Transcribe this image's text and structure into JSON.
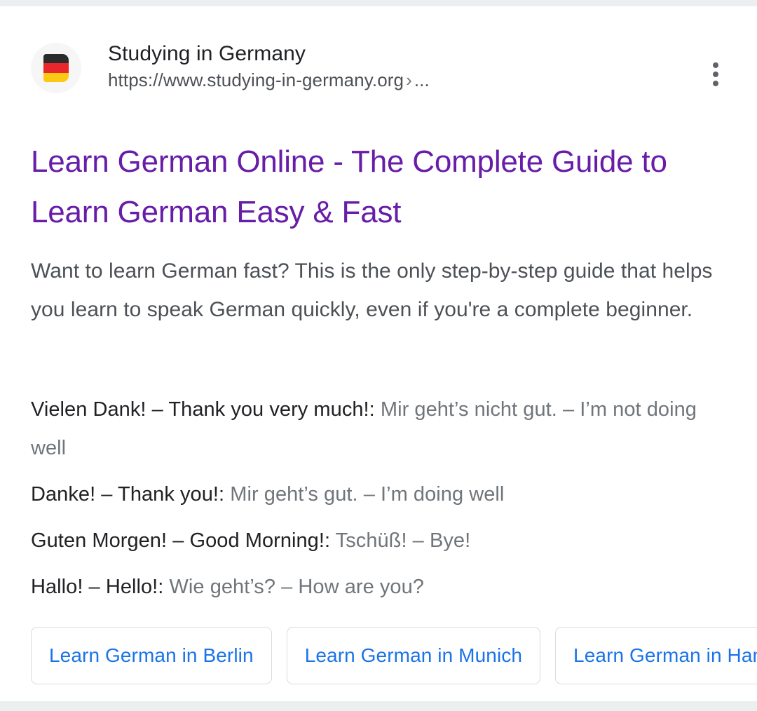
{
  "result": {
    "site": {
      "name": "Studying in Germany",
      "url": "https://www.studying-in-germany.org",
      "url_separator": "›",
      "url_ellipsis": "...",
      "favicon": "german-flag-icon"
    },
    "more_options_icon": "three-dot-menu-icon",
    "title": "Learn German Online - The Complete Guide to Learn German Easy & Fast",
    "snippet": "Want to learn German fast? This is the only step-by-step guide that helps you learn to speak German quickly, even if you're a complete beginner.",
    "phrases": [
      {
        "term": "Vielen Dank! – Thank you very much!:",
        "definition": "Mir geht’s nicht gut. – I’m not doing well"
      },
      {
        "term": "Danke! – Thank you!:",
        "definition": "Mir geht’s gut. – I’m doing well"
      },
      {
        "term": "Guten Morgen! – Good Morning!:",
        "definition": "Tschüß! – Bye!"
      },
      {
        "term": "Hallo! – Hello!:",
        "definition": "Wie geht’s? – How are you?"
      }
    ],
    "related_chips": [
      {
        "label": "Learn German in Berlin"
      },
      {
        "label": "Learn German in Munich"
      },
      {
        "label": "Learn German in Hamburg"
      }
    ]
  },
  "colors": {
    "visited_link": "#681da8",
    "chip_link": "#1a73e8",
    "primary_text": "#202124",
    "secondary_text": "#4d5156",
    "muted_text": "#70757a",
    "border": "#dadce0",
    "chrome_band": "#eceff0",
    "flag_black": "#2b2b2b",
    "flag_red": "#e8262b",
    "flag_gold": "#fbc813"
  }
}
